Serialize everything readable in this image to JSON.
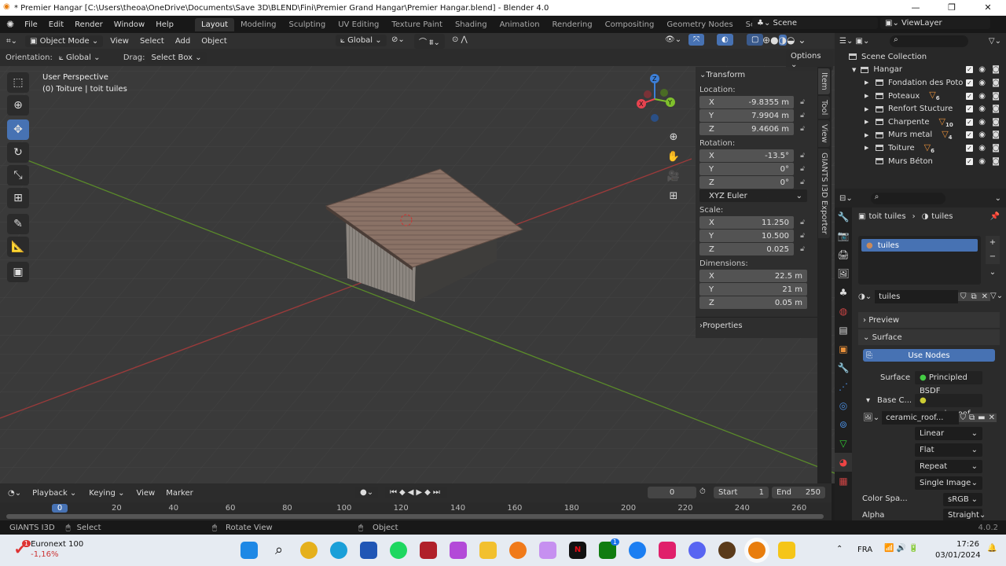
{
  "window": {
    "title": "* Premier Hangar [C:\\Users\\theoa\\OneDrive\\Documents\\Save 3D\\BLEND\\Fini\\Premier Grand Hangar\\Premier Hangar.blend] - Blender 4.0",
    "minimize": "—",
    "maximize": "❐",
    "close": "✕"
  },
  "menu": [
    "File",
    "Edit",
    "Render",
    "Window",
    "Help"
  ],
  "workspaces": [
    "Layout",
    "Modeling",
    "Sculpting",
    "UV Editing",
    "Texture Paint",
    "Shading",
    "Animation",
    "Rendering",
    "Compositing",
    "Geometry Nodes",
    "Scripting",
    "+"
  ],
  "scene": {
    "label": "Scene",
    "view_layer": "ViewLayer"
  },
  "viewport_header": {
    "mode": "Object Mode",
    "menus": [
      "View",
      "Select",
      "Add",
      "Object"
    ],
    "transform_orientation": "Global"
  },
  "tool_header": {
    "orientation_label": "Orientation:",
    "orientation": "Global",
    "drag_label": "Drag:",
    "drag": "Select Box",
    "options": "Options"
  },
  "viewport": {
    "perspective": "User Perspective",
    "object_info": "(0) Toiture | toit tuiles",
    "gizmo": {
      "x": "X",
      "y": "Y",
      "z": "Z"
    }
  },
  "n_panel": {
    "tabs": [
      "Item",
      "Tool",
      "View",
      "GIANTS I3D Exporter"
    ],
    "transform": "Transform",
    "location_label": "Location:",
    "location": [
      {
        "axis": "X",
        "value": "-9.8355 m"
      },
      {
        "axis": "Y",
        "value": "7.9904 m"
      },
      {
        "axis": "Z",
        "value": "9.4606 m"
      }
    ],
    "rotation_label": "Rotation:",
    "rotation": [
      {
        "axis": "X",
        "value": "-13.5°"
      },
      {
        "axis": "Y",
        "value": "0°"
      },
      {
        "axis": "Z",
        "value": "0°"
      }
    ],
    "rotation_mode": "XYZ Euler",
    "scale_label": "Scale:",
    "scale": [
      {
        "axis": "X",
        "value": "11.250"
      },
      {
        "axis": "Y",
        "value": "10.500"
      },
      {
        "axis": "Z",
        "value": "0.025"
      }
    ],
    "dimensions_label": "Dimensions:",
    "dimensions": [
      {
        "axis": "X",
        "value": "22.5 m"
      },
      {
        "axis": "Y",
        "value": "21 m"
      },
      {
        "axis": "Z",
        "value": "0.05 m"
      }
    ],
    "properties": "Properties"
  },
  "outliner": {
    "root": "Scene Collection",
    "collection": "Hangar",
    "items": [
      {
        "name": "Fondation des Poto",
        "badge": ""
      },
      {
        "name": "Poteaux",
        "badge": "6"
      },
      {
        "name": "Renfort Stucture",
        "badge": ""
      },
      {
        "name": "Charpente",
        "badge": "10"
      },
      {
        "name": "Murs metal",
        "badge": "4"
      },
      {
        "name": "Toiture",
        "badge": "6"
      },
      {
        "name": "Murs Béton",
        "badge": ""
      }
    ]
  },
  "properties": {
    "breadcrumb_object": "toit tuiles",
    "breadcrumb_material": "tuiles",
    "slot": "tuiles",
    "material_name": "tuiles",
    "preview": "Preview",
    "surface": "Surface",
    "use_nodes": "Use Nodes",
    "surface_label": "Surface",
    "surface_value": "Principled BSDF",
    "base_color_label": "Base C...",
    "base_color_value": "ceramic_roof_...",
    "image_name": "ceramic_roof...",
    "interpolation": "Linear",
    "projection": "Flat",
    "extension": "Repeat",
    "source": "Single Image",
    "color_space_label": "Color Spa...",
    "color_space": "sRGB",
    "alpha_label": "Alpha",
    "alpha": "Straight"
  },
  "timeline": {
    "menus": [
      "Playback",
      "Keying",
      "View",
      "Marker"
    ],
    "current_frame": "0",
    "start_label": "Start",
    "start": "1",
    "end_label": "End",
    "end": "250",
    "ticks": [
      "0",
      "20",
      "40",
      "60",
      "80",
      "100",
      "120",
      "140",
      "160",
      "180",
      "200",
      "220",
      "240",
      "260"
    ]
  },
  "status": {
    "addon": "GIANTS I3D",
    "select": "Select",
    "rotate": "Rotate View",
    "object": "Object",
    "version": "4.0.2"
  },
  "taskbar": {
    "widget_name": "Euronext 100",
    "widget_value": "-1,16%",
    "widget_badge": "1",
    "xbox_badge": "1",
    "language": "FRA",
    "time": "17:26",
    "date": "03/01/2024"
  },
  "colors": {
    "accent": "#4772b3",
    "x_axis": "#e8434f",
    "y_axis": "#7fc02c",
    "z_axis": "#3c7fd8",
    "badge": "#e8903a"
  }
}
